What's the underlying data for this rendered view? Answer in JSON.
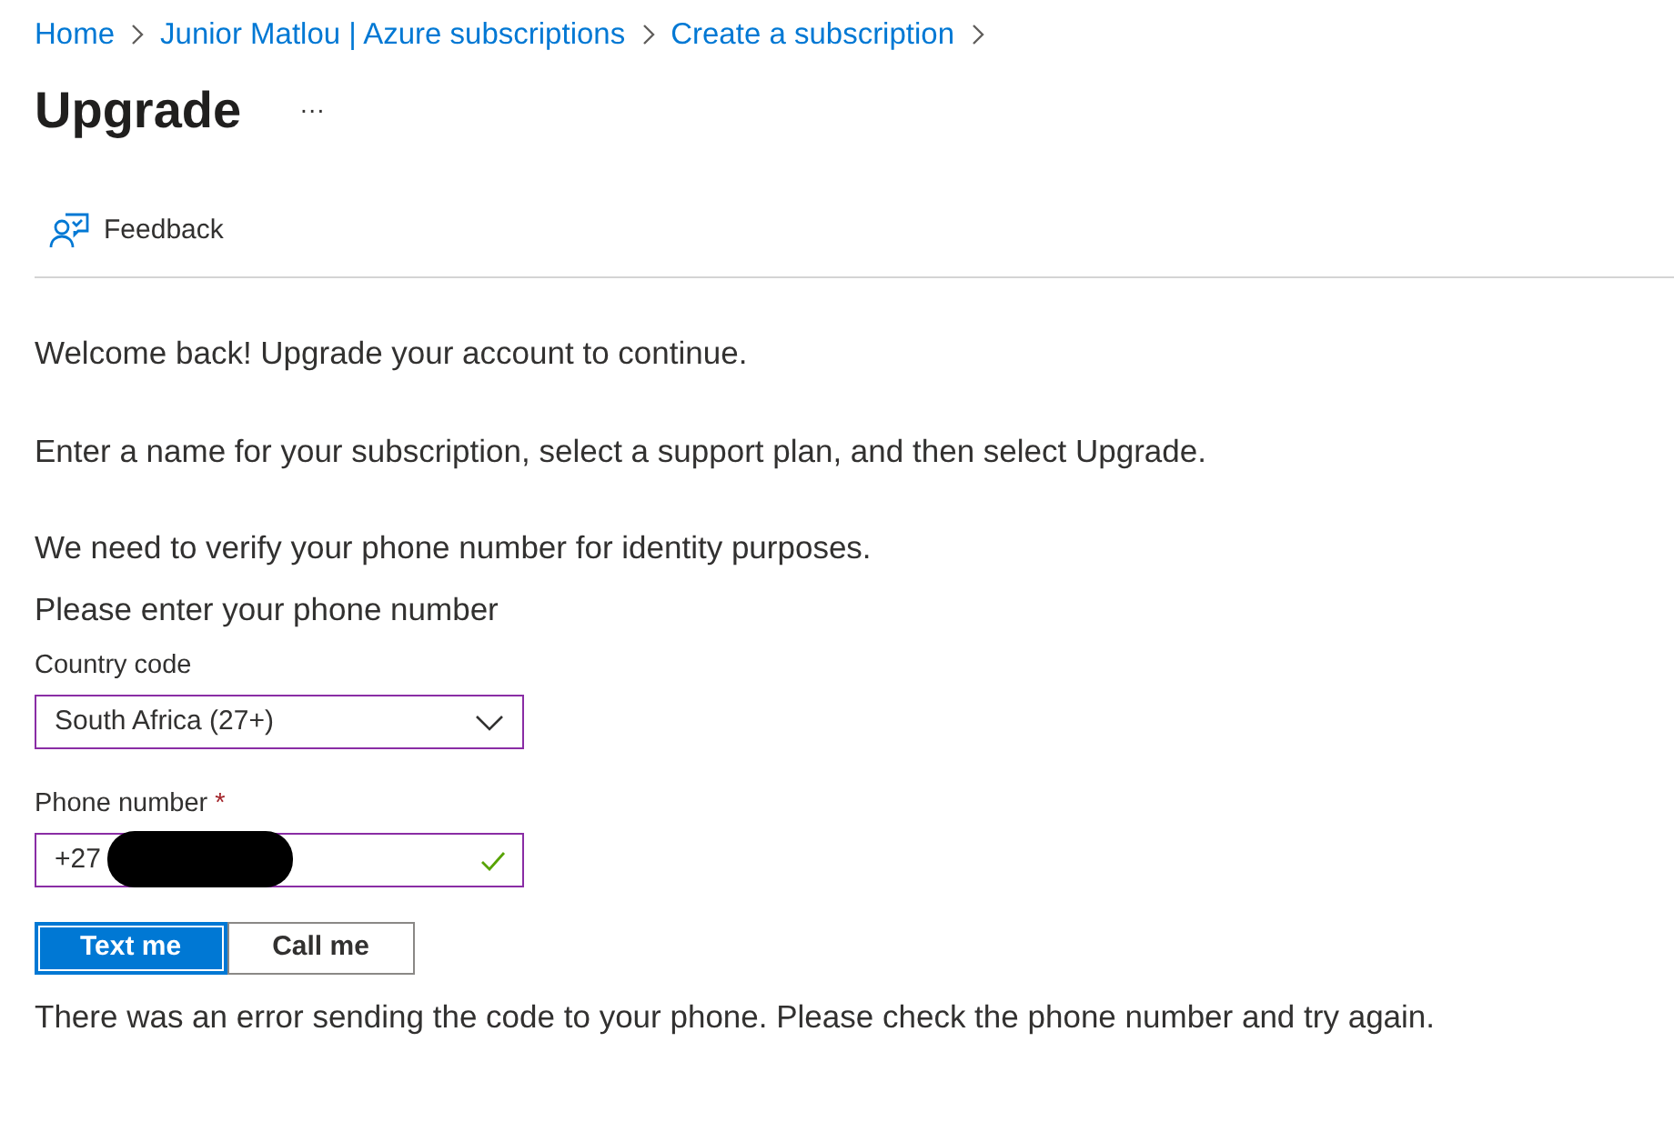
{
  "breadcrumb": [
    {
      "label": "Home"
    },
    {
      "label": "Junior Matlou | Azure subscriptions"
    },
    {
      "label": "Create a subscription"
    }
  ],
  "title": "Upgrade",
  "more": "···",
  "toolbar": [
    {
      "label": "Feedback"
    }
  ],
  "paragraphs": [
    "Welcome back! Upgrade your account to continue.",
    "Enter a name for your subscription, select a support plan, and then select Upgrade."
  ],
  "verify_intro": "We need to verify your phone number for identity purposes.",
  "prompt": "Please enter your phone number",
  "country_code": {
    "label": "Country code",
    "value": "South Africa (27+)"
  },
  "phone_number": {
    "label": "Phone number",
    "required": true,
    "required_mark": "*",
    "value": "+27",
    "valid": true,
    "redacted": true
  },
  "methods": [
    {
      "label": "Text me",
      "selected": true
    },
    {
      "label": "Call me",
      "selected": false
    }
  ],
  "error": "There was an error sending the code to your phone. Please check the phone number and try again."
}
